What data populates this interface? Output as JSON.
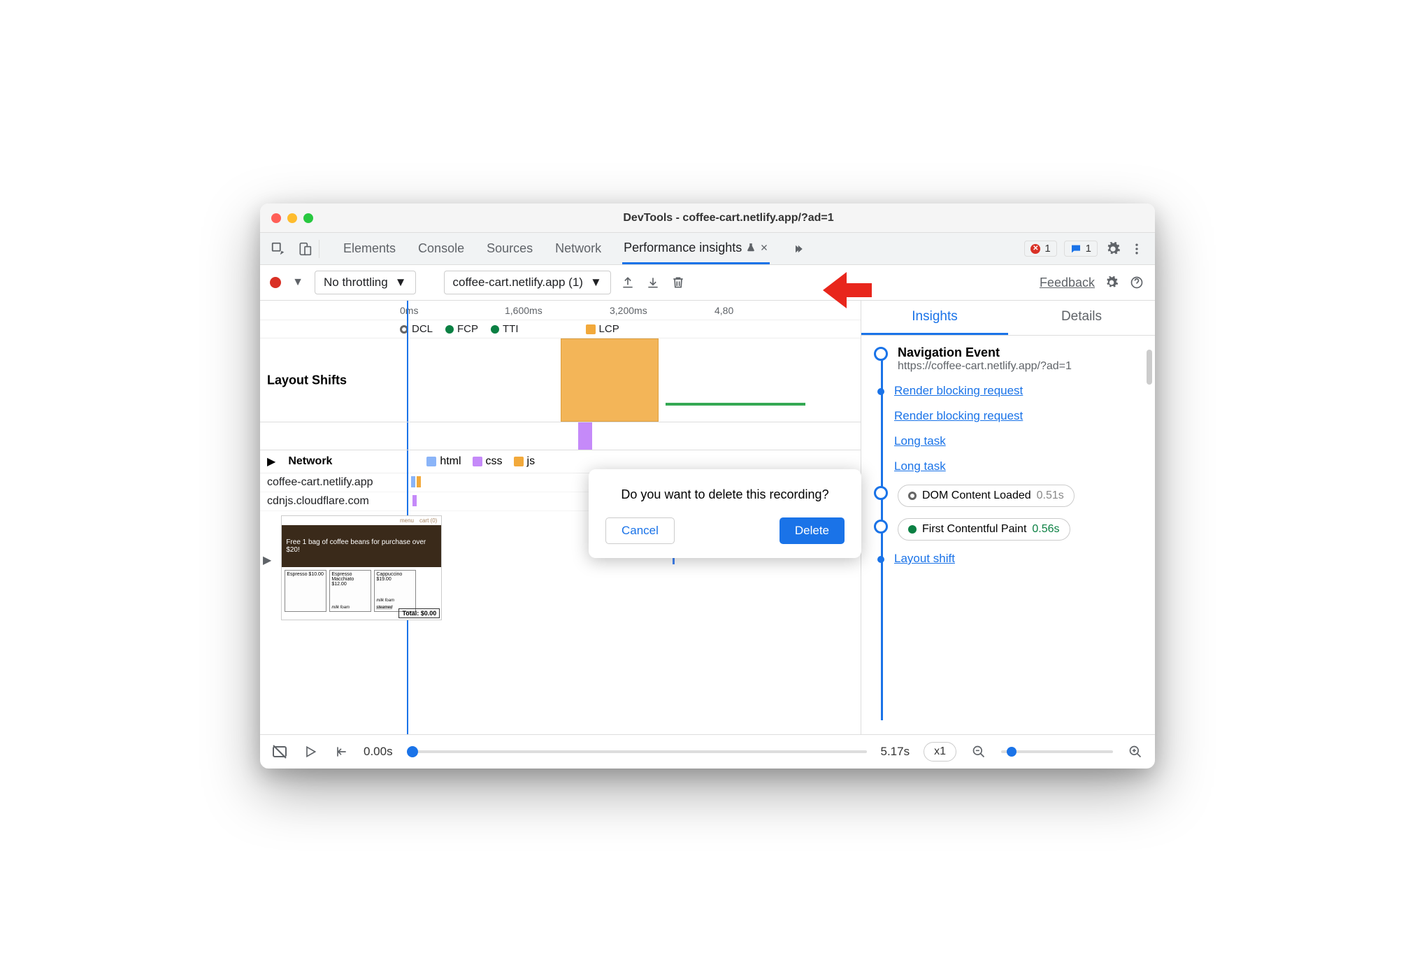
{
  "window": {
    "title": "DevTools - coffee-cart.netlify.app/?ad=1"
  },
  "panels": {
    "items": [
      "Elements",
      "Console",
      "Sources",
      "Network",
      "Performance insights"
    ],
    "active_index": 4
  },
  "top_right": {
    "error_count": "1",
    "message_count": "1"
  },
  "toolbar": {
    "throttling": "No throttling",
    "recording_name": "coffee-cart.netlify.app (1)",
    "feedback": "Feedback"
  },
  "ruler": {
    "ticks": [
      "0ms",
      "1,600ms",
      "3,200ms",
      "4,80"
    ]
  },
  "markers": {
    "items": [
      {
        "label": "DCL",
        "type": "ring"
      },
      {
        "label": "FCP",
        "color": "#0b8043",
        "type": "circ"
      },
      {
        "label": "TTI",
        "color": "#0b8043",
        "type": "circ"
      },
      {
        "label": "LCP",
        "color": "#f2a93b",
        "type": "sq"
      }
    ]
  },
  "tracks": {
    "layout_shifts": "Layout Shifts",
    "network": "Network"
  },
  "network_legend": [
    {
      "label": "html",
      "color": "#8ab4f8"
    },
    {
      "label": "css",
      "color": "#c58af9"
    },
    {
      "label": "js",
      "color": "#f2a93b"
    }
  ],
  "network_hosts": [
    "coffee-cart.netlify.app",
    "cdnjs.cloudflare.com"
  ],
  "thumbnail": {
    "banner": "Free 1 bag of coffee beans for purchase over $20!",
    "menu": "menu",
    "cart": "cart (0)",
    "cups": [
      "Espresso $10.00",
      "Espresso Macchiato $12.00",
      "Cappuccino $19.00"
    ],
    "foam": "milk foam",
    "steamed": "steamed",
    "total": "Total: $0.00"
  },
  "right_panel": {
    "tabs": [
      "Insights",
      "Details"
    ],
    "active": 0,
    "nav_event": {
      "title": "Navigation Event",
      "url": "https://coffee-cart.netlify.app/?ad=1"
    },
    "links": [
      "Render blocking request",
      "Render blocking request",
      "Long task",
      "Long task"
    ],
    "dcl": {
      "label": "DOM Content Loaded",
      "time": "0.51s"
    },
    "fcp": {
      "label": "First Contentful Paint",
      "time": "0.56s"
    },
    "layout_shift": "Layout shift"
  },
  "footer": {
    "start": "0.00s",
    "end": "5.17s",
    "speed": "x1"
  },
  "modal": {
    "text": "Do you want to delete this recording?",
    "cancel": "Cancel",
    "delete": "Delete"
  }
}
